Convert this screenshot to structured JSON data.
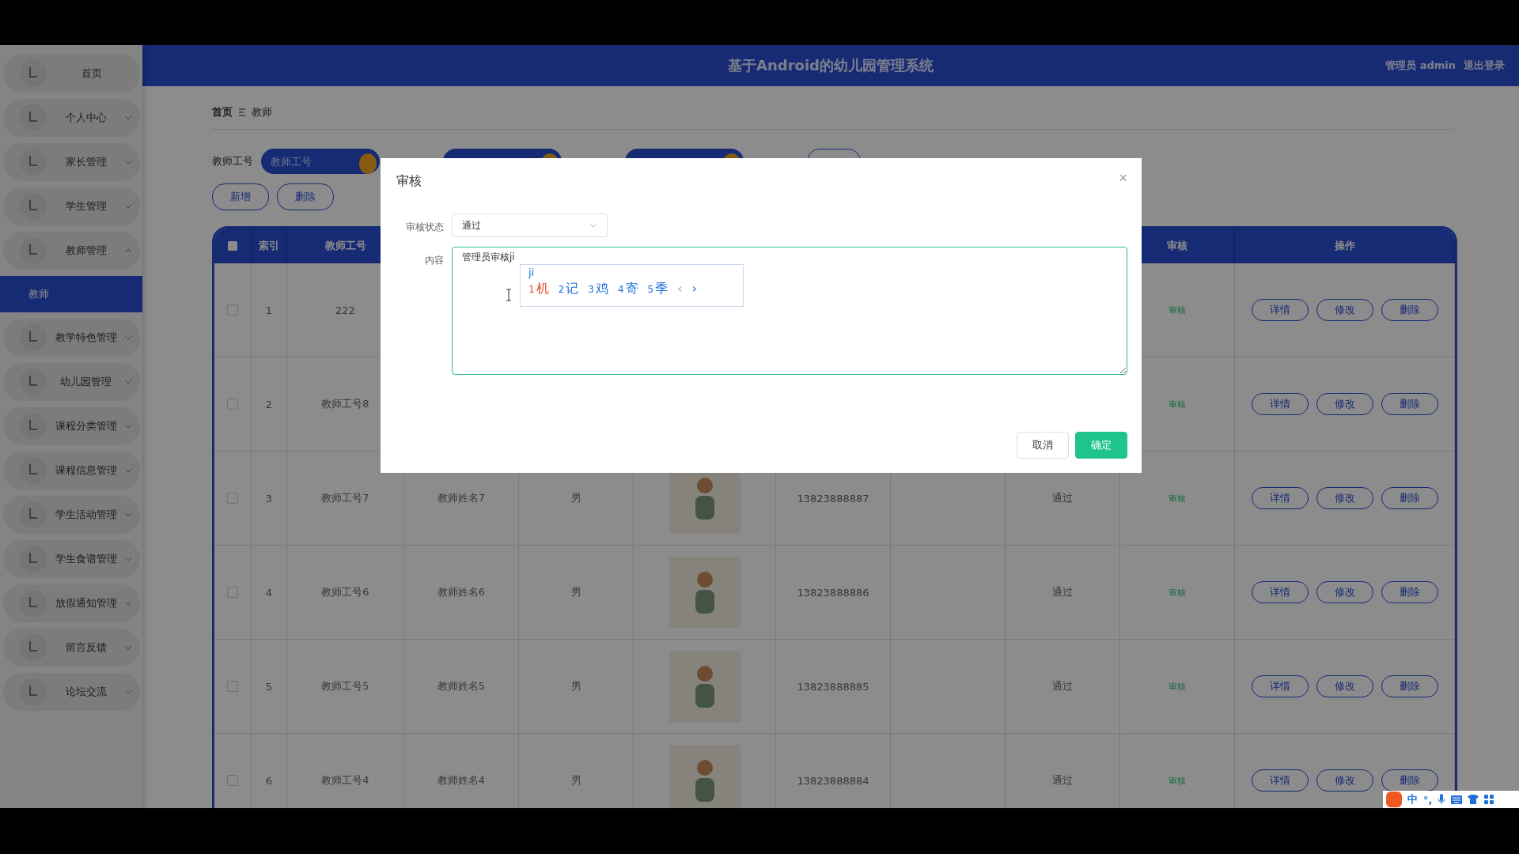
{
  "header": {
    "title": "基于Android的幼儿园管理系统",
    "user": "管理员 admin",
    "logout": "退出登录"
  },
  "sidebar": {
    "items": [
      {
        "label": "首页"
      },
      {
        "label": "个人中心",
        "expanded": false
      },
      {
        "label": "家长管理",
        "expanded": false
      },
      {
        "label": "学生管理",
        "expanded": false
      },
      {
        "label": "教师管理",
        "expanded": true,
        "children": [
          {
            "label": "教师",
            "selected": true
          }
        ]
      },
      {
        "label": "教学特色管理",
        "expanded": false
      },
      {
        "label": "幼儿园管理",
        "expanded": false
      },
      {
        "label": "课程分类管理",
        "expanded": false
      },
      {
        "label": "课程信息管理",
        "expanded": false
      },
      {
        "label": "学生活动管理",
        "expanded": false
      },
      {
        "label": "学生食谱管理",
        "expanded": false
      },
      {
        "label": "放假通知管理",
        "expanded": false
      },
      {
        "label": "留言反馈",
        "expanded": false
      },
      {
        "label": "论坛交流",
        "expanded": false
      }
    ]
  },
  "breadcrumb": [
    "首页",
    "教师"
  ],
  "search": {
    "label": "教师工号",
    "placeholder": "教师工号"
  },
  "actions": [
    "新增",
    "删除"
  ],
  "table": {
    "select_all_checked": false,
    "index_header": "索引",
    "id_header": "教师工号",
    "audit_header": "审核",
    "actions_header": "操作",
    "rows": [
      {
        "checked": false,
        "index": "1",
        "id": "222",
        "photo": false,
        "audit": "审核",
        "actions": [
          "详情",
          "修改",
          "删除"
        ]
      },
      {
        "checked": false,
        "index": "2",
        "id": "教师工号8",
        "photo": false,
        "audit": "审核",
        "actions": [
          "详情",
          "修改",
          "删除"
        ]
      },
      {
        "checked": false,
        "index": "3",
        "id": "教师工号7",
        "name": "教师姓名7",
        "gender": "男",
        "photo": true,
        "phone": "13823888887",
        "status": "通过",
        "audit": "审核",
        "actions": [
          "详情",
          "修改",
          "删除"
        ]
      },
      {
        "checked": false,
        "index": "4",
        "id": "教师工号6",
        "name": "教师姓名6",
        "gender": "男",
        "photo": true,
        "phone": "13823888886",
        "status": "通过",
        "audit": "审核",
        "actions": [
          "详情",
          "修改",
          "删除"
        ]
      },
      {
        "checked": false,
        "index": "5",
        "id": "教师工号5",
        "name": "教师姓名5",
        "gender": "男",
        "photo": true,
        "phone": "13823888885",
        "status": "通过",
        "audit": "审核",
        "actions": [
          "详情",
          "修改",
          "删除"
        ]
      },
      {
        "checked": false,
        "index": "6",
        "id": "教师工号4",
        "name": "教师姓名4",
        "gender": "男",
        "photo": true,
        "phone": "13823888884",
        "status": "通过",
        "audit": "审核",
        "actions": [
          "详情",
          "修改",
          "删除"
        ]
      }
    ]
  },
  "dialog": {
    "title": "审核",
    "close": "×",
    "fields": [
      {
        "kind": "select",
        "label": "审核状态",
        "value": "通过"
      },
      {
        "kind": "textarea",
        "label": "内容",
        "value": "管理员审核ji"
      }
    ],
    "buttons": [
      {
        "kind": "default",
        "label": "取消"
      },
      {
        "kind": "primary",
        "label": "确定"
      }
    ]
  },
  "ime": {
    "composition": "ji",
    "candidates": [
      {
        "number": "1",
        "text": "机",
        "selected": true
      },
      {
        "number": "2",
        "text": "记",
        "selected": false
      },
      {
        "number": "3",
        "text": "鸡",
        "selected": false
      },
      {
        "number": "4",
        "text": "寄",
        "selected": false
      },
      {
        "number": "5",
        "text": "季",
        "selected": false
      }
    ],
    "prev": {
      "label": "‹",
      "disabled": true
    },
    "next": {
      "label": "›",
      "disabled": false
    }
  },
  "ime_toolbar": {
    "mode": "中",
    "punctuation": "°,"
  }
}
